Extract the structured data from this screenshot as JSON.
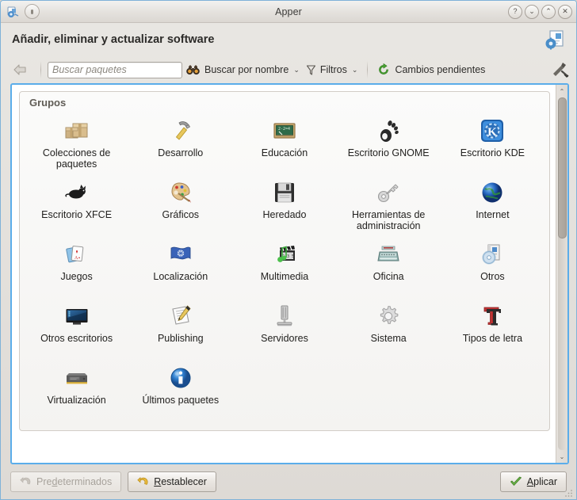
{
  "window": {
    "title": "Apper",
    "app_icon": "apper-icon",
    "shade_button": "window-menu-button",
    "controls": [
      {
        "name": "help-button",
        "glyph": "?"
      },
      {
        "name": "minimize-button",
        "glyph": "⌄"
      },
      {
        "name": "maximize-button",
        "glyph": "⌃"
      },
      {
        "name": "close-button",
        "glyph": "✕"
      }
    ]
  },
  "header": {
    "title": "Añadir, eliminar y actualizar software",
    "icon": "software-properties-icon"
  },
  "toolbar": {
    "back_icon": "back-arrow-icon",
    "search": {
      "placeholder": "Buscar paquetes",
      "value": ""
    },
    "search_mode": {
      "label": "Buscar por nombre",
      "icon": "binoculars-icon",
      "arrow": "⌄"
    },
    "filters": {
      "label": "Filtros",
      "icon": "funnel-icon",
      "arrow": "⌄"
    },
    "pending": {
      "label": "Cambios pendientes",
      "icon": "refresh-green-icon"
    },
    "right_icon": "tools-icon"
  },
  "content": {
    "group_title": "Grupos",
    "groups": [
      {
        "label": "Colecciones de paquetes",
        "icon": "packages-icon"
      },
      {
        "label": "Desarrollo",
        "icon": "hammer-icon"
      },
      {
        "label": "Educación",
        "icon": "blackboard-icon"
      },
      {
        "label": "Escritorio GNOME",
        "icon": "gnome-foot-icon"
      },
      {
        "label": "Escritorio KDE",
        "icon": "kde-gear-k-icon"
      },
      {
        "label": "Escritorio XFCE",
        "icon": "xfce-mouse-icon"
      },
      {
        "label": "Gráficos",
        "icon": "palette-icon"
      },
      {
        "label": "Heredado",
        "icon": "floppy-disk-icon"
      },
      {
        "label": "Herramientas de administración",
        "icon": "key-icon"
      },
      {
        "label": "Internet",
        "icon": "globe-icon"
      },
      {
        "label": "Juegos",
        "icon": "playing-cards-icon"
      },
      {
        "label": "Localización",
        "icon": "un-flag-icon"
      },
      {
        "label": "Multimedia",
        "icon": "clapperboard-note-icon"
      },
      {
        "label": "Oficina",
        "icon": "typewriter-icon"
      },
      {
        "label": "Otros",
        "icon": "cd-box-icon"
      },
      {
        "label": "Otros escritorios",
        "icon": "monitor-icon"
      },
      {
        "label": "Publishing",
        "icon": "pencil-paper-icon"
      },
      {
        "label": "Servidores",
        "icon": "server-tower-icon"
      },
      {
        "label": "Sistema",
        "icon": "gear-icon"
      },
      {
        "label": "Tipos de letra",
        "icon": "fonts-tt-icon"
      },
      {
        "label": "Virtualización",
        "icon": "hard-drive-icon"
      },
      {
        "label": "Últimos paquetes",
        "icon": "info-icon"
      }
    ]
  },
  "scrollbar": {
    "up_arrow": "⌃",
    "down_arrow": "⌄",
    "thumb_percent": 40
  },
  "footer": {
    "defaults": {
      "label": "Predeterminados",
      "icon": "undo-icon",
      "enabled": false,
      "mnemonic": "d"
    },
    "reset": {
      "label": "Restablecer",
      "icon": "undo-yellow-icon",
      "enabled": true,
      "mnemonic": "R"
    },
    "apply": {
      "label": "Aplicar",
      "icon": "check-green-icon",
      "enabled": true,
      "mnemonic": "A"
    }
  },
  "colors": {
    "accent": "#5badea",
    "window_bg": "#dedad5",
    "content_bg": "#ffffff"
  }
}
